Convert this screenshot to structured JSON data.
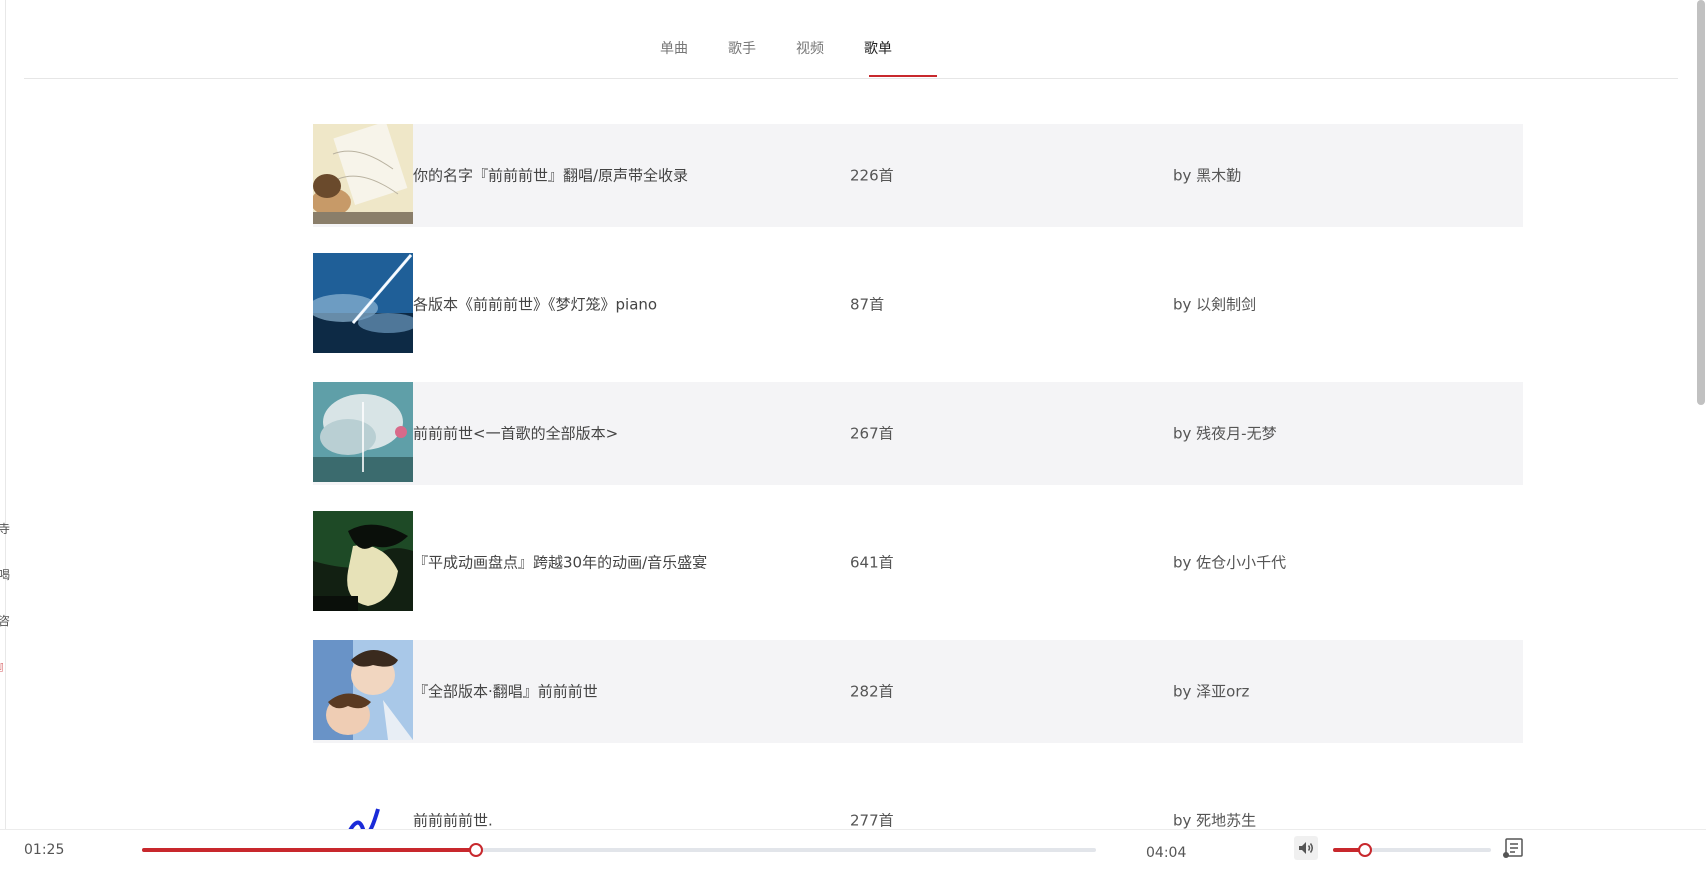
{
  "tabs": [
    {
      "label": "单曲"
    },
    {
      "label": "歌手"
    },
    {
      "label": "视频"
    },
    {
      "label": "歌单"
    }
  ],
  "active_tab": "歌单",
  "playlists": [
    {
      "name": "你的名字『前前前世』翻唱/原声带全收录",
      "count": "226首",
      "creator": "by 黑木勤",
      "cover": "cover-sketch"
    },
    {
      "name": "各版本《前前前世》《梦灯笼》piano",
      "count": "87首",
      "creator": "by 以剣制剑",
      "cover": "cover-comet-sky"
    },
    {
      "name": "前前前世<一首歌的全部版本>",
      "count": "267首",
      "creator": "by 残夜月-无梦",
      "cover": "cover-clouds"
    },
    {
      "name": "『平成动画盘点』跨越30年的动画/音乐盛宴",
      "count": "641首",
      "creator": "by 佐仓小小千代",
      "cover": "cover-dark-portrait"
    },
    {
      "name": "『全部版本·翻唱』前前前世",
      "count": "282首",
      "creator": "by 泽亚orz",
      "cover": "cover-anime-duo"
    },
    {
      "name": "前前前前世.",
      "count": "277首",
      "creator": "by 死地苏生",
      "cover": "cover-blue-squiggle"
    }
  ],
  "player": {
    "current_time": "01:25",
    "total_time": "04:04",
    "progress": 0.35,
    "volume": 0.2,
    "accent": "#c8282d",
    "icons": {
      "volume": "speaker-icon",
      "playlist": "playlist-icon"
    }
  },
  "left_edge_chars": [
    "寺",
    "喝",
    "咨",
    "』"
  ]
}
